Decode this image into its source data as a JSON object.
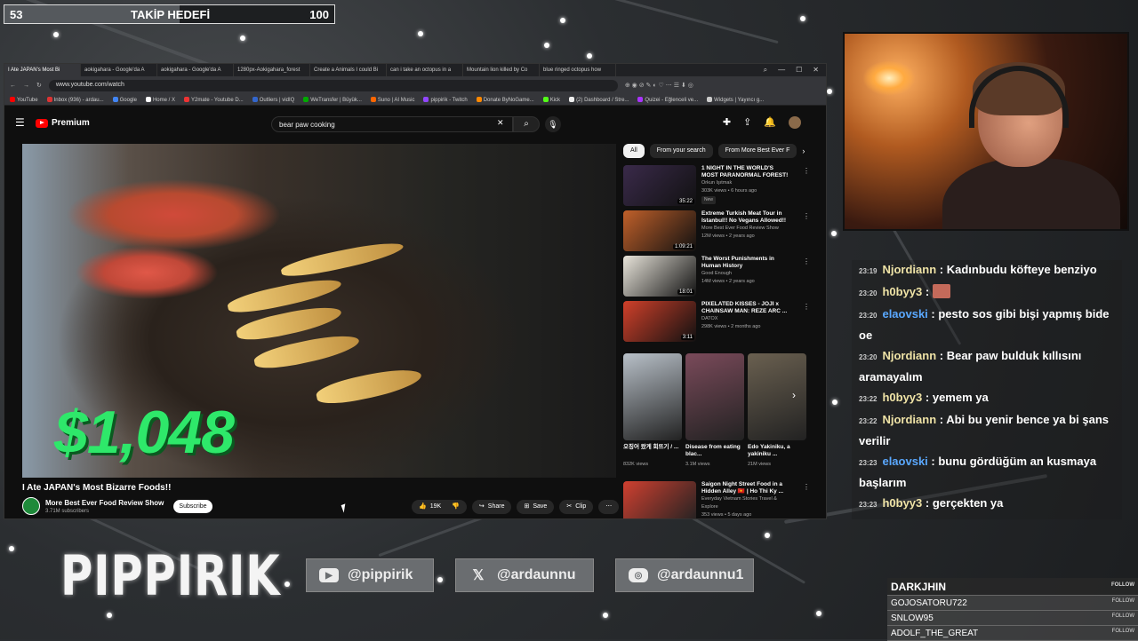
{
  "goal": {
    "current": "53",
    "label": "TAKİP HEDEFİ",
    "target": "100",
    "progress_fraction": 0.53
  },
  "browser": {
    "tabs": [
      "I Ate JAPAN's Most Bi",
      "aokigahara - Google'da A",
      "aokigahara - Google'da A",
      "1280px-Aokigahara_forest",
      "Create a Animals I could Bi",
      "can i take an octopus in a",
      "Mountain lion killed by Co",
      "blue ringed octopus how"
    ],
    "url": "www.youtube.com/watch",
    "bookmarks": [
      "YouTube",
      "Inbox (936) - ardau...",
      "Google",
      "Home / X",
      "Y2mate - Youtube D...",
      "Outliers | vidIQ",
      "WeTransfer | Büyük...",
      "Suno | AI Music",
      "pippirik - Twitch",
      "Donate ByNoGame...",
      "Kick",
      "(2) Dashboard / Stre...",
      "Quizei - Eğlenceli ve...",
      "Widgets | Yayıncı g..."
    ]
  },
  "youtube": {
    "logo": "Premium",
    "search_query": "bear paw cooking",
    "video_overlay": "$1,048",
    "video_title": "I Ate JAPAN's Most Bizarre Foods!!",
    "channel": "More Best Ever Food Review Show",
    "subscribers": "3.71M subscribers",
    "subscribe": "Subscribe",
    "likes": "19K",
    "share": "Share",
    "save": "Save",
    "clip": "Clip",
    "chips": [
      "All",
      "From your search",
      "From More Best Ever F"
    ],
    "recommendations": [
      {
        "title": "1 NIGHT IN THE WORLD'S MOST PARANORMAL FOREST!",
        "channel": "Orkun Işıtmak",
        "meta": "303K views • 6 hours ago",
        "badge": "New",
        "duration": "35:22",
        "color": "#3a2a4a"
      },
      {
        "title": "Extreme Turkish Meat Tour in Istanbul!! No Vegans Allowed!!",
        "channel": "More Best Ever Food Review Show",
        "meta": "12M views • 2 years ago",
        "badge": "",
        "duration": "1:09:21",
        "color": "#c0602a"
      },
      {
        "title": "The Worst Punishments in Human History",
        "channel": "Good Enough",
        "meta": "14M views • 2 years ago",
        "badge": "",
        "duration": "18:01",
        "color": "#e8e4da"
      },
      {
        "title": "PIXELATED KISSES - JOJI x CHAINSAW MAN: REZE ARC ...",
        "channel": "DATOX",
        "meta": "298K views • 2 months ago",
        "badge": "",
        "duration": "3:11",
        "color": "#d0402a"
      }
    ],
    "shorts": [
      {
        "title": "오징어 왔게 회뜨기 / ...",
        "views": "832K views",
        "color": "#b8c0c8"
      },
      {
        "title": "Disease from eating blac...",
        "views": "3.1M views",
        "color": "#7a4a5a"
      },
      {
        "title": "Edo Yakiniku, a yakiniku ...",
        "views": "21M views",
        "color": "#6a6050"
      }
    ],
    "last_rec": {
      "title": "Saigon Night Street Food in a Hidden Alley 🇻🇳 | Ho Thi Ky ...",
      "channel": "Everyday Vietnam Stories Travel & Explore",
      "meta": "353 views • 5 days ago",
      "color": "#d04030"
    }
  },
  "chat": [
    {
      "time": "23:19",
      "user": "Njordiann",
      "cls": "u1",
      "text": "Kadınbudu köfteye benziyo",
      "emote": false
    },
    {
      "time": "23:20",
      "user": "h0byy3",
      "cls": "u1",
      "text": "",
      "emote": true
    },
    {
      "time": "23:20",
      "user": "elaovski",
      "cls": "u2",
      "text": "pesto sos gibi bişi yapmış bide oe",
      "emote": false
    },
    {
      "time": "23:20",
      "user": "Njordiann",
      "cls": "u1",
      "text": "Bear paw bulduk kıllısını aramayalım",
      "emote": false
    },
    {
      "time": "23:22",
      "user": "h0byy3",
      "cls": "u1",
      "text": "yemem ya",
      "emote": false
    },
    {
      "time": "23:22",
      "user": "Njordiann",
      "cls": "u1",
      "text": "Abi bu yenir bence ya bi şans verilir",
      "emote": false
    },
    {
      "time": "23:23",
      "user": "elaovski",
      "cls": "u2",
      "text": "bunu gördüğüm an kusmaya başlarım",
      "emote": false
    },
    {
      "time": "23:23",
      "user": "h0byy3",
      "cls": "u1",
      "text": "gerçekten ya",
      "emote": false
    }
  ],
  "brand": "PIPPIRIK",
  "socials": [
    {
      "icon": "youtube-icon",
      "handle": "@pippirik"
    },
    {
      "icon": "x-icon",
      "handle": "@ardaunnu"
    },
    {
      "icon": "instagram-icon",
      "handle": "@ardaunnu1"
    }
  ],
  "followers": {
    "tag": "FOLLOW",
    "names": [
      "DARKJHIN",
      "GOJOSATORU722",
      "SNLOW95",
      "ADOLF_THE_GREAT"
    ]
  }
}
